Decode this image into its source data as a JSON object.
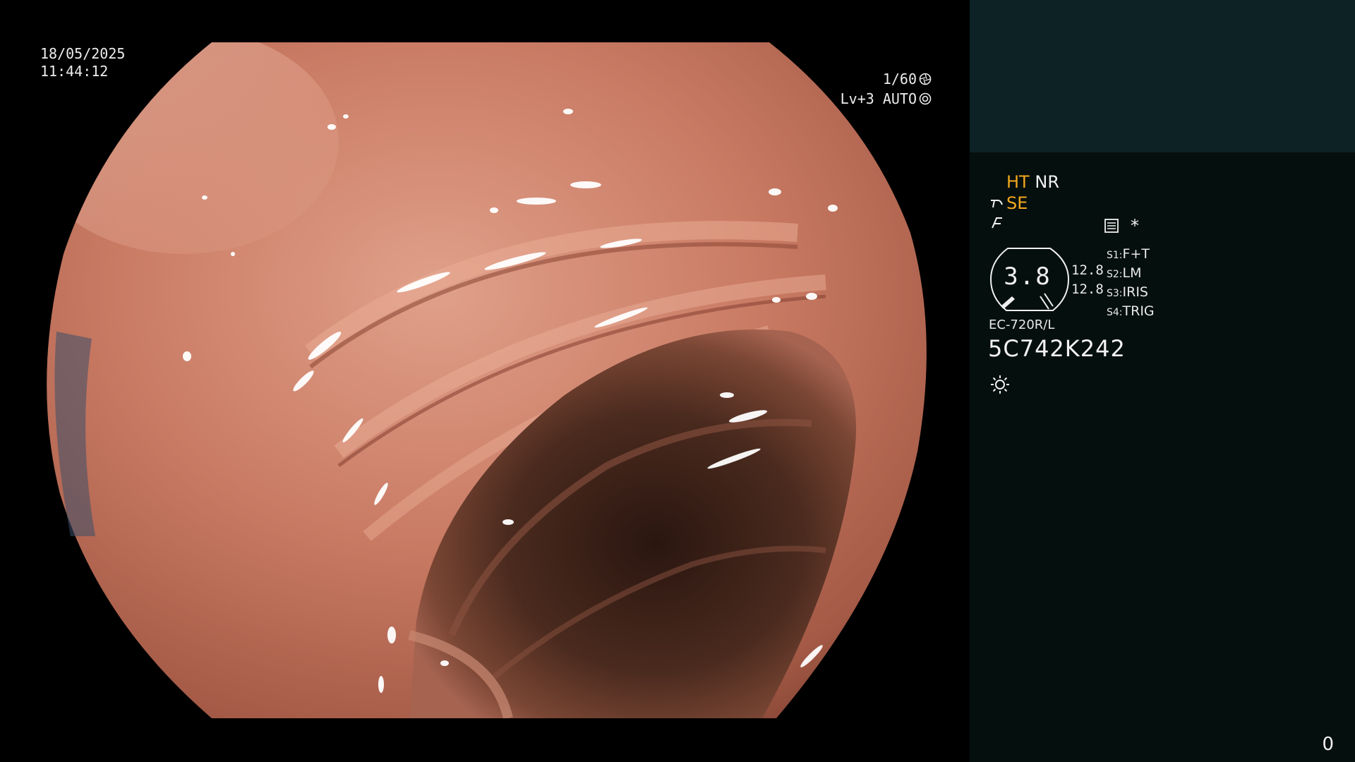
{
  "image_panel": {
    "date": "18/05/2025",
    "time": "11:44:12",
    "shutter": "1/60",
    "level_mode": "Lv+3 AUTO"
  },
  "status_panel": {
    "ht_label": "HT",
    "nr_label": "NR",
    "se_label": "SE",
    "asterisk": "*",
    "dial_value": "3.8",
    "dial_side_top": "12.8",
    "dial_side_bottom": "12.8",
    "switches": [
      {
        "key": "S1:",
        "value": "F+T"
      },
      {
        "key": "S2:",
        "value": "LM"
      },
      {
        "key": "S3:",
        "value": "IRIS"
      },
      {
        "key": "S4:",
        "value": "TRIG"
      }
    ],
    "scope_model": "EC-720R/L",
    "serial_number": "5C742K242",
    "counter": "0"
  },
  "colors": {
    "accent_orange": "#f2a81e",
    "panel_top": "#0d2224",
    "panel_bg": "#050f0e",
    "mucosa": "#c97a63"
  },
  "icons": [
    "shutter-icon",
    "auto-iris-icon",
    "walking-icon",
    "freeze-icon",
    "menu-icon",
    "lamp-icon"
  ]
}
